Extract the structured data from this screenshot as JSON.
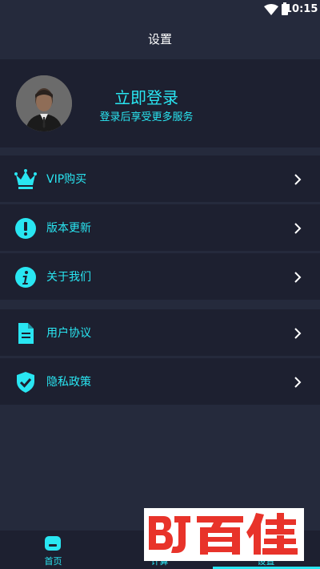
{
  "status_bar": {
    "time": "10:15",
    "icons": [
      "wifi-icon",
      "battery-icon"
    ]
  },
  "header": {
    "title": "设置"
  },
  "profile": {
    "login_title": "立即登录",
    "login_subtitle": "登录后享受更多服务"
  },
  "menu": {
    "group1": [
      {
        "label": "VIP购买",
        "icon": "crown-icon"
      },
      {
        "label": "版本更新",
        "icon": "exclamation-icon"
      },
      {
        "label": "关于我们",
        "icon": "info-icon"
      }
    ],
    "group2": [
      {
        "label": "用户协议",
        "icon": "document-icon"
      },
      {
        "label": "隐私政策",
        "icon": "shield-check-icon"
      }
    ]
  },
  "tabs": [
    {
      "label": "首页",
      "icon": "home-icon"
    },
    {
      "label": "计算",
      "icon": "calculator-icon"
    },
    {
      "label": "设置",
      "icon": "settings-icon",
      "active": true
    }
  ],
  "watermark": {
    "text": "BJ百佳"
  },
  "colors": {
    "accent": "#29e6f2",
    "background": "#252a3c",
    "card": "#1d2030",
    "watermark_red": "#e8332a"
  }
}
